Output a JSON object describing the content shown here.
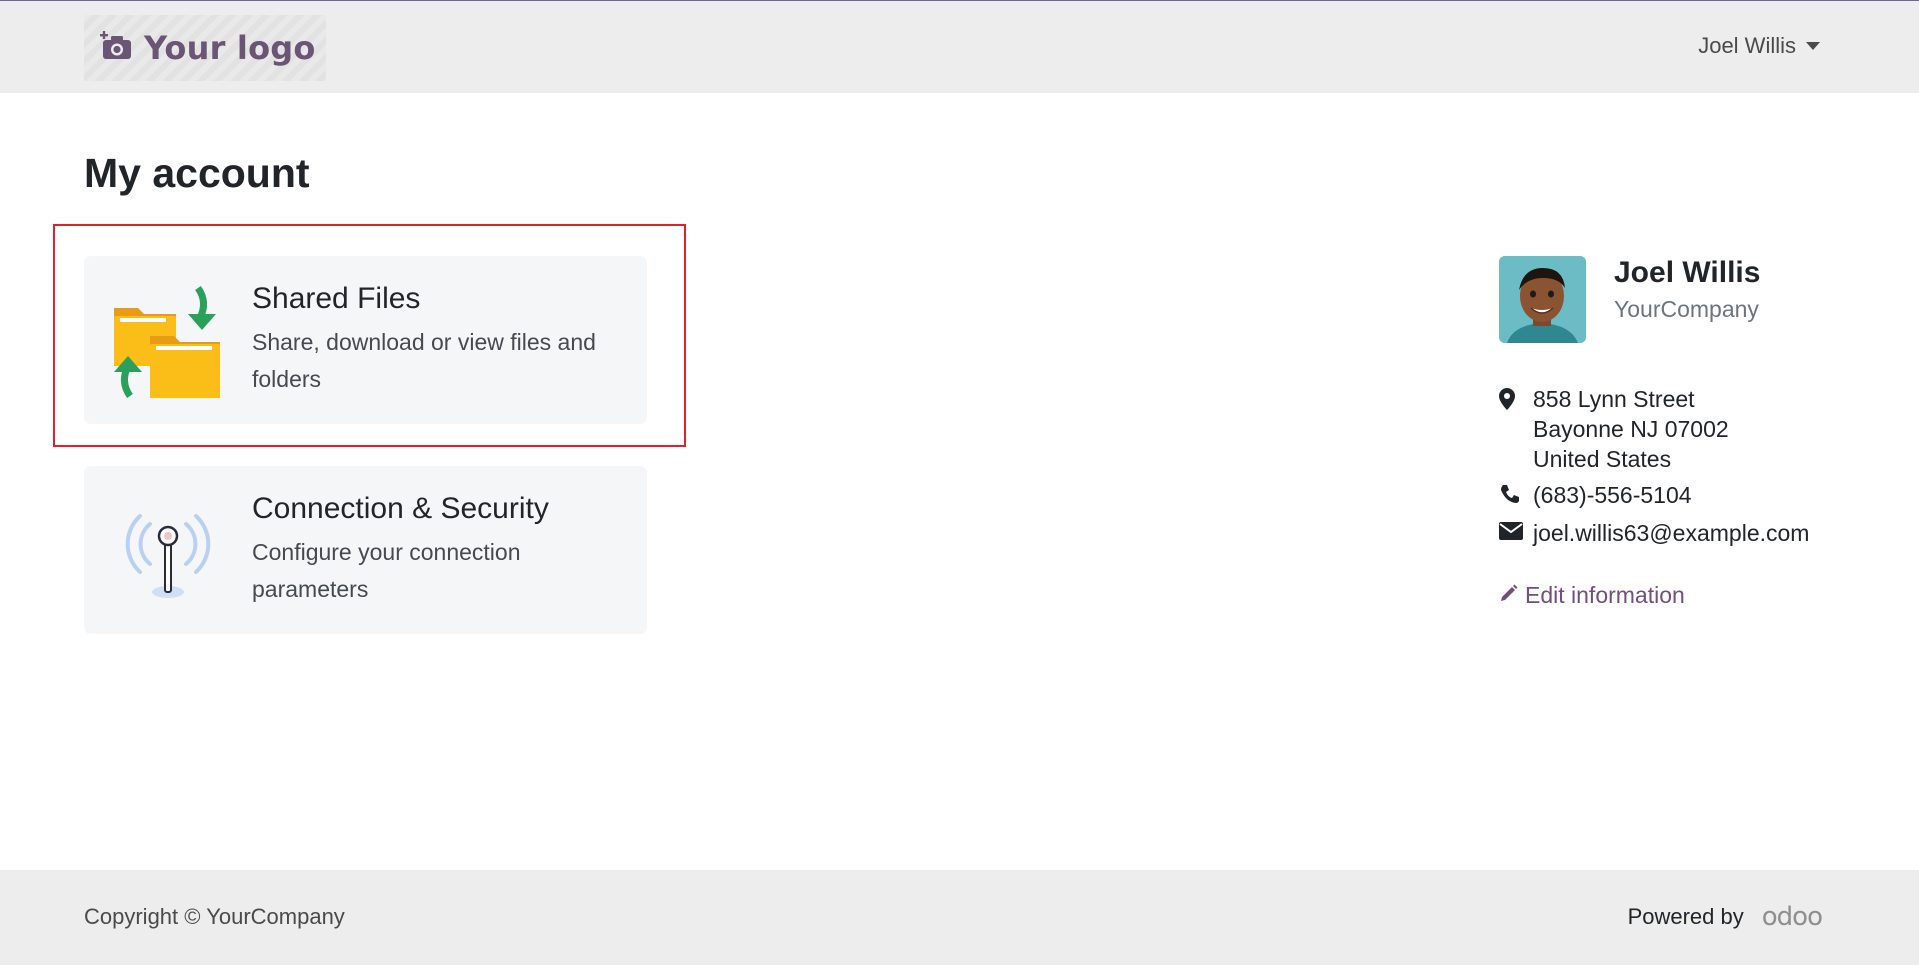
{
  "header": {
    "logo_text": "Your logo",
    "user_name": "Joel Willis"
  },
  "main": {
    "title": "My account",
    "cards": [
      {
        "title": "Shared Files",
        "description": "Share, download or view files and folders",
        "icon": "shared-folders-icon"
      },
      {
        "title": "Connection & Security",
        "description": "Configure your connection parameters",
        "icon": "antenna-signal-icon"
      }
    ]
  },
  "profile": {
    "name": "Joel Willis",
    "company": "YourCompany",
    "address_line1": "858 Lynn Street",
    "address_line2": "Bayonne NJ 07002",
    "address_line3": "United States",
    "phone": "(683)-556-5104",
    "email": "joel.willis63@example.com",
    "edit_label": "Edit information"
  },
  "footer": {
    "copyright": "Copyright © YourCompany",
    "powered_by": "Powered by",
    "brand": "odoo"
  },
  "colors": {
    "accent": "#71507a",
    "highlight": "#e0202c",
    "card_bg": "#f5f6f8",
    "header_bg": "#ededed"
  }
}
